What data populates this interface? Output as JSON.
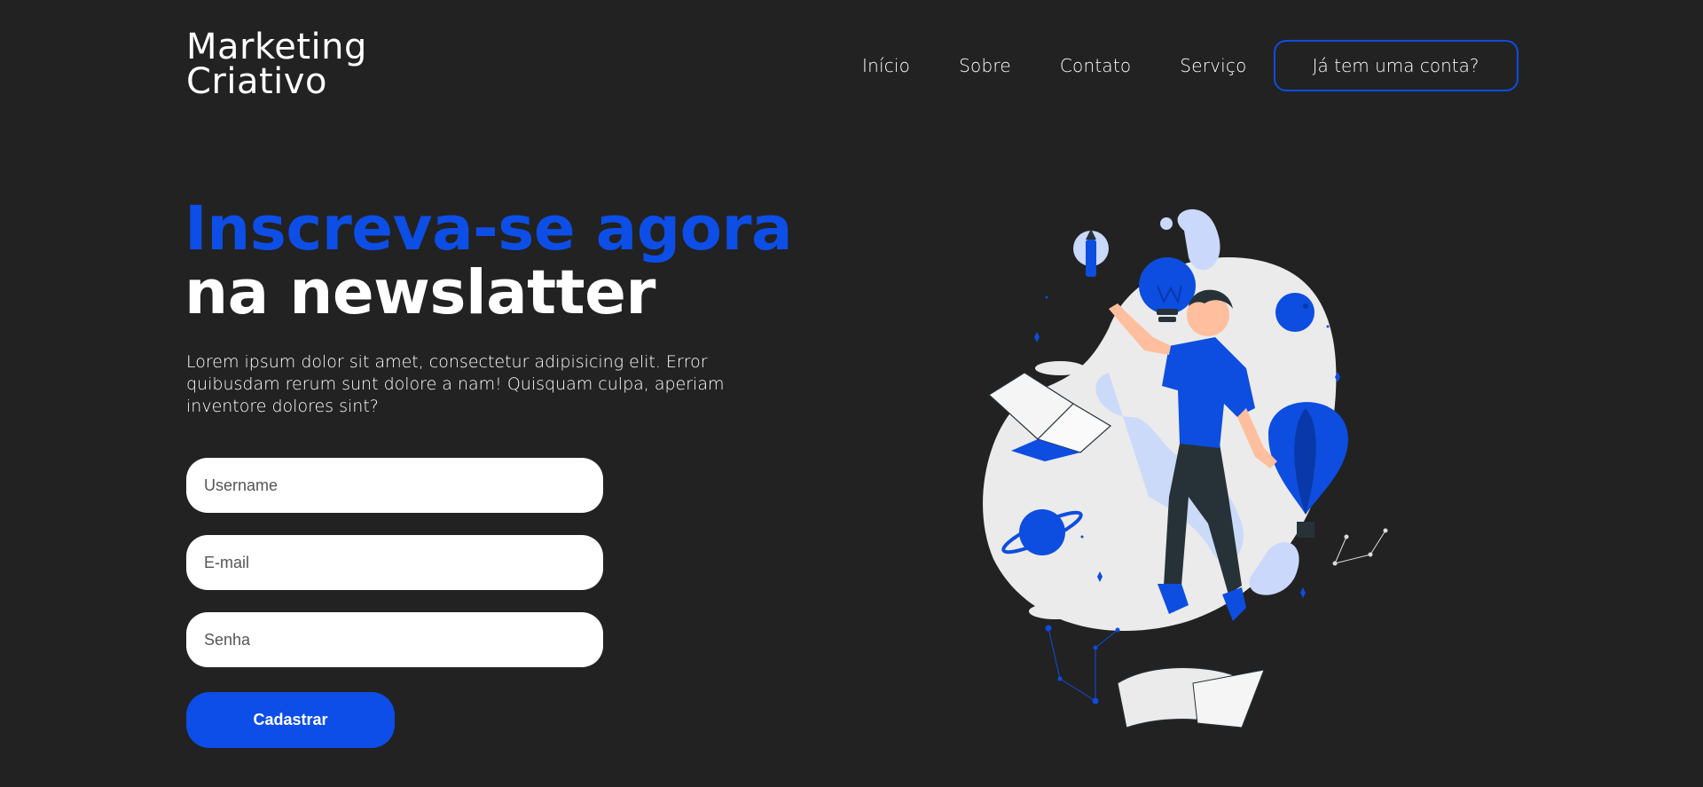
{
  "header": {
    "logo_line1": "Marketing",
    "logo_line2": "Criativo",
    "nav": [
      "Início",
      "Sobre",
      "Contato",
      "Serviço"
    ],
    "account_button": "Já tem uma conta?"
  },
  "hero": {
    "headline_line1": "Inscreva-se agora",
    "headline_line2": "na newslatter",
    "description": "Lorem ipsum dolor sit amet, consectetur adipisicing elit. Error quibusdam rerum sunt dolore a nam! Quisquam culpa, aperiam inventore dolores sint?"
  },
  "form": {
    "username_placeholder": "Username",
    "email_placeholder": "E-mail",
    "password_placeholder": "Senha",
    "submit_label": "Cadastrar"
  },
  "illustration": {
    "name": "person-floating-illustration",
    "colors": {
      "accent": "#0d4de0",
      "light": "#c9d8fb",
      "blob": "#ebebeb",
      "dark": "#263238"
    }
  },
  "theme": {
    "background": "#222222",
    "accent": "#0d4de0",
    "text": "#ffffff"
  }
}
